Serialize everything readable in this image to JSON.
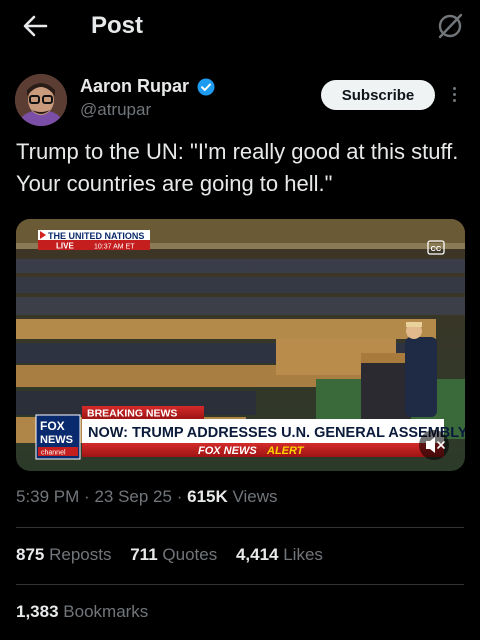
{
  "header": {
    "title": "Post",
    "back_icon": "arrow-left-icon",
    "grok_icon": "grok-icon"
  },
  "author": {
    "name": "Aaron Rupar",
    "handle": "@atrupar",
    "verified_color": "#1d9bf0",
    "subscribe_label": "Subscribe",
    "more_icon": "more-vertical-icon"
  },
  "tweet": {
    "text": "Trump to the UN: \"I'm really good at this stuff. Your countries are going to hell.\""
  },
  "video": {
    "top_banner": "THE UNITED NATIONS",
    "live_label": "LIVE",
    "live_time": "10:37 AM ET",
    "cc_label": "CC",
    "breaking_label": "BREAKING NEWS",
    "headline": "NOW: TRUMP ADDRESSES U.N. GENERAL ASSEMBLY",
    "alert_brand": "FOX NEWS",
    "alert_word": "ALERT",
    "logo_line1": "FOX",
    "logo_line2": "NEWS",
    "logo_line3": "channel",
    "mute_icon": "volume-muted-icon"
  },
  "meta": {
    "time": "5:39 PM",
    "date": "23 Sep 25",
    "views_count": "615K",
    "views_label": "Views",
    "separator": "·"
  },
  "stats": {
    "reposts_count": "875",
    "reposts_label": "Reposts",
    "quotes_count": "711",
    "quotes_label": "Quotes",
    "likes_count": "4,414",
    "likes_label": "Likes",
    "bookmarks_count": "1,383",
    "bookmarks_label": "Bookmarks"
  }
}
